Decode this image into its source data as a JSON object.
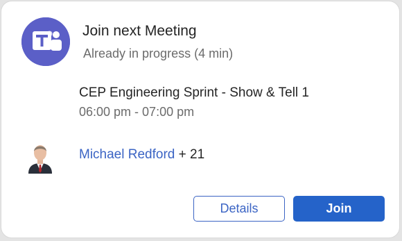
{
  "notification": {
    "app_icon": "microsoft-teams-icon",
    "title": "Join next Meeting",
    "subtitle": "Already in progress (4 min)"
  },
  "meeting": {
    "name": "CEP Engineering Sprint - Show & Tell 1",
    "time": "06:00 pm - 07:00 pm"
  },
  "attendees": {
    "organizer": "Michael Redford",
    "others": " + 21"
  },
  "actions": {
    "details_label": "Details",
    "join_label": "Join"
  },
  "colors": {
    "brand_purple": "#5b5fc7",
    "accent_blue": "#2563c9",
    "link_blue": "#3b64c4"
  }
}
